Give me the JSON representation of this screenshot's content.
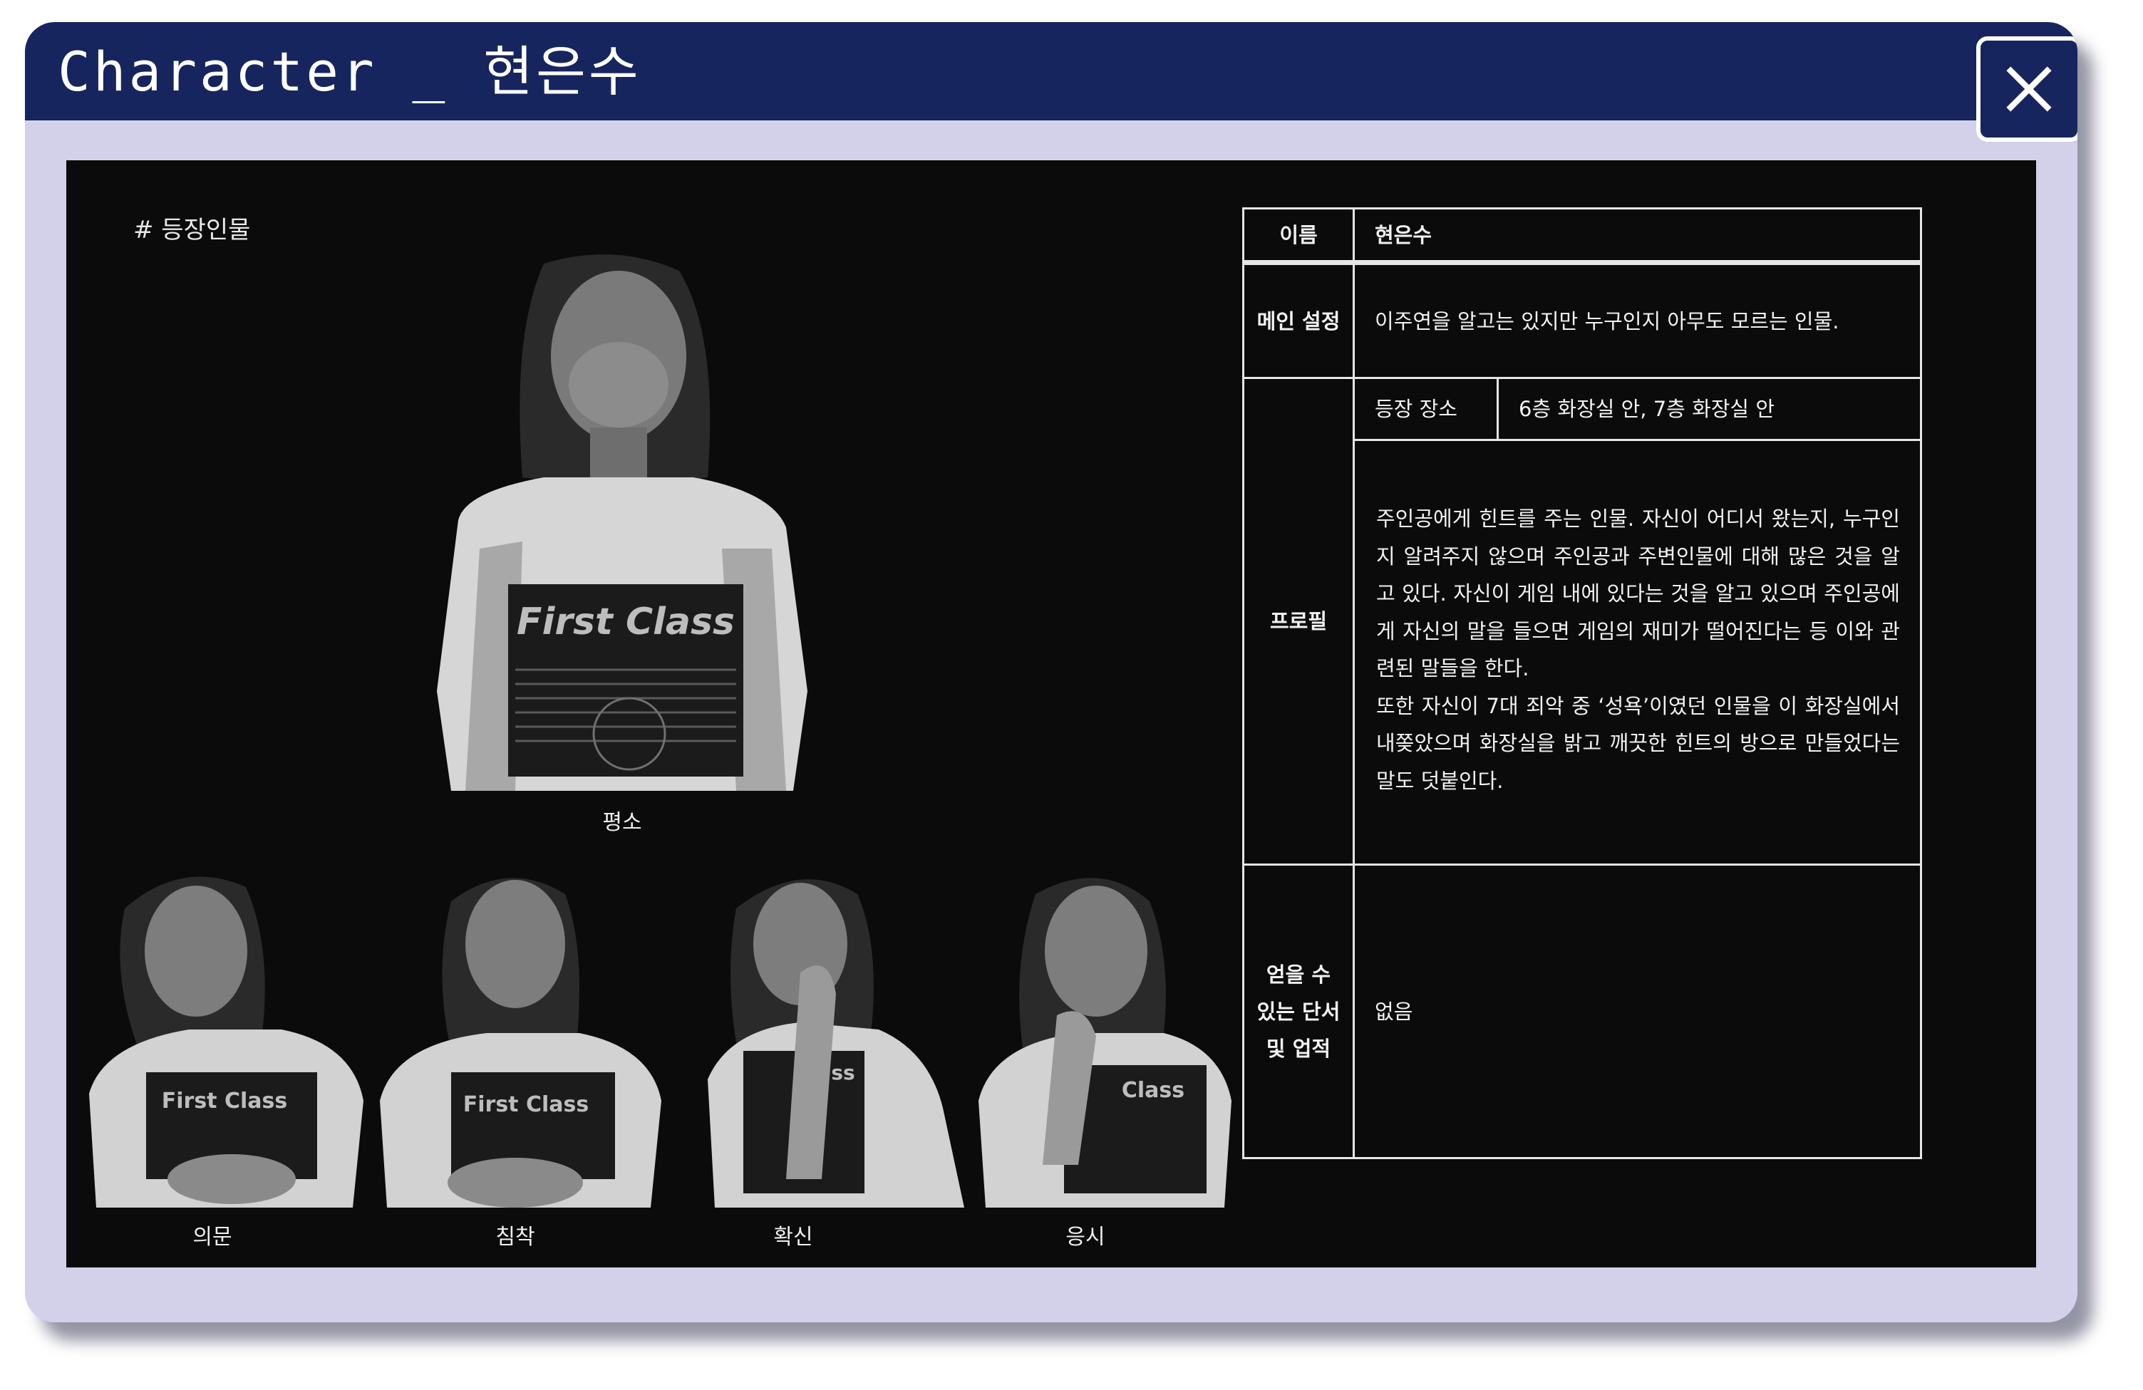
{
  "window": {
    "title": "Character _ 현은수",
    "close_icon": "close-icon",
    "colors": {
      "titlebar": "#17255f",
      "frame": "#d3d1e9",
      "content_bg": "#0b0b0b"
    }
  },
  "section": {
    "label": "# 등장인물"
  },
  "figures": [
    {
      "caption": "평소",
      "shirt_text": "First Class"
    },
    {
      "caption": "의문",
      "shirt_text": "First Class"
    },
    {
      "caption": "침착",
      "shirt_text": "First Class"
    },
    {
      "caption": "확신",
      "shirt_text": "ss"
    },
    {
      "caption": "응시",
      "shirt_text": "Class"
    }
  ],
  "table": {
    "name_label": "이름",
    "name_value": "현은수",
    "main_setting_label": "메인 설정",
    "main_setting_value": "이주연을 알고는 있지만 누구인지 아무도 모르는 인물.",
    "profile_label": "프로필",
    "location_label": "등장 장소",
    "location_value": "6층 화장실 안, 7층 화장실 안",
    "profile_paragraph_1": "주인공에게 힌트를 주는 인물. 자신이 어디서 왔는지, 누구인지 알려주지 않으며 주인공과 주변인물에 대해 많은 것을 알고 있다. 자신이 게임 내에 있다는 것을 알고 있으며 주인공에게 자신의 말을 들으면 게임의 재미가 떨어진다는 등 이와 관련된 말들을 한다.",
    "profile_paragraph_2": "또한 자신이 7대 죄악 중 ‘성욕’이였던 인물을 이 화장실에서 내쫒았으며 화장실을 밝고 깨끗한 힌트의 방으로 만들었다는 말도 덧붙인다.",
    "clues_label_1": "얻을 수",
    "clues_label_2": "있는 단서",
    "clues_label_3": "및 업적",
    "clues_value": "없음"
  }
}
